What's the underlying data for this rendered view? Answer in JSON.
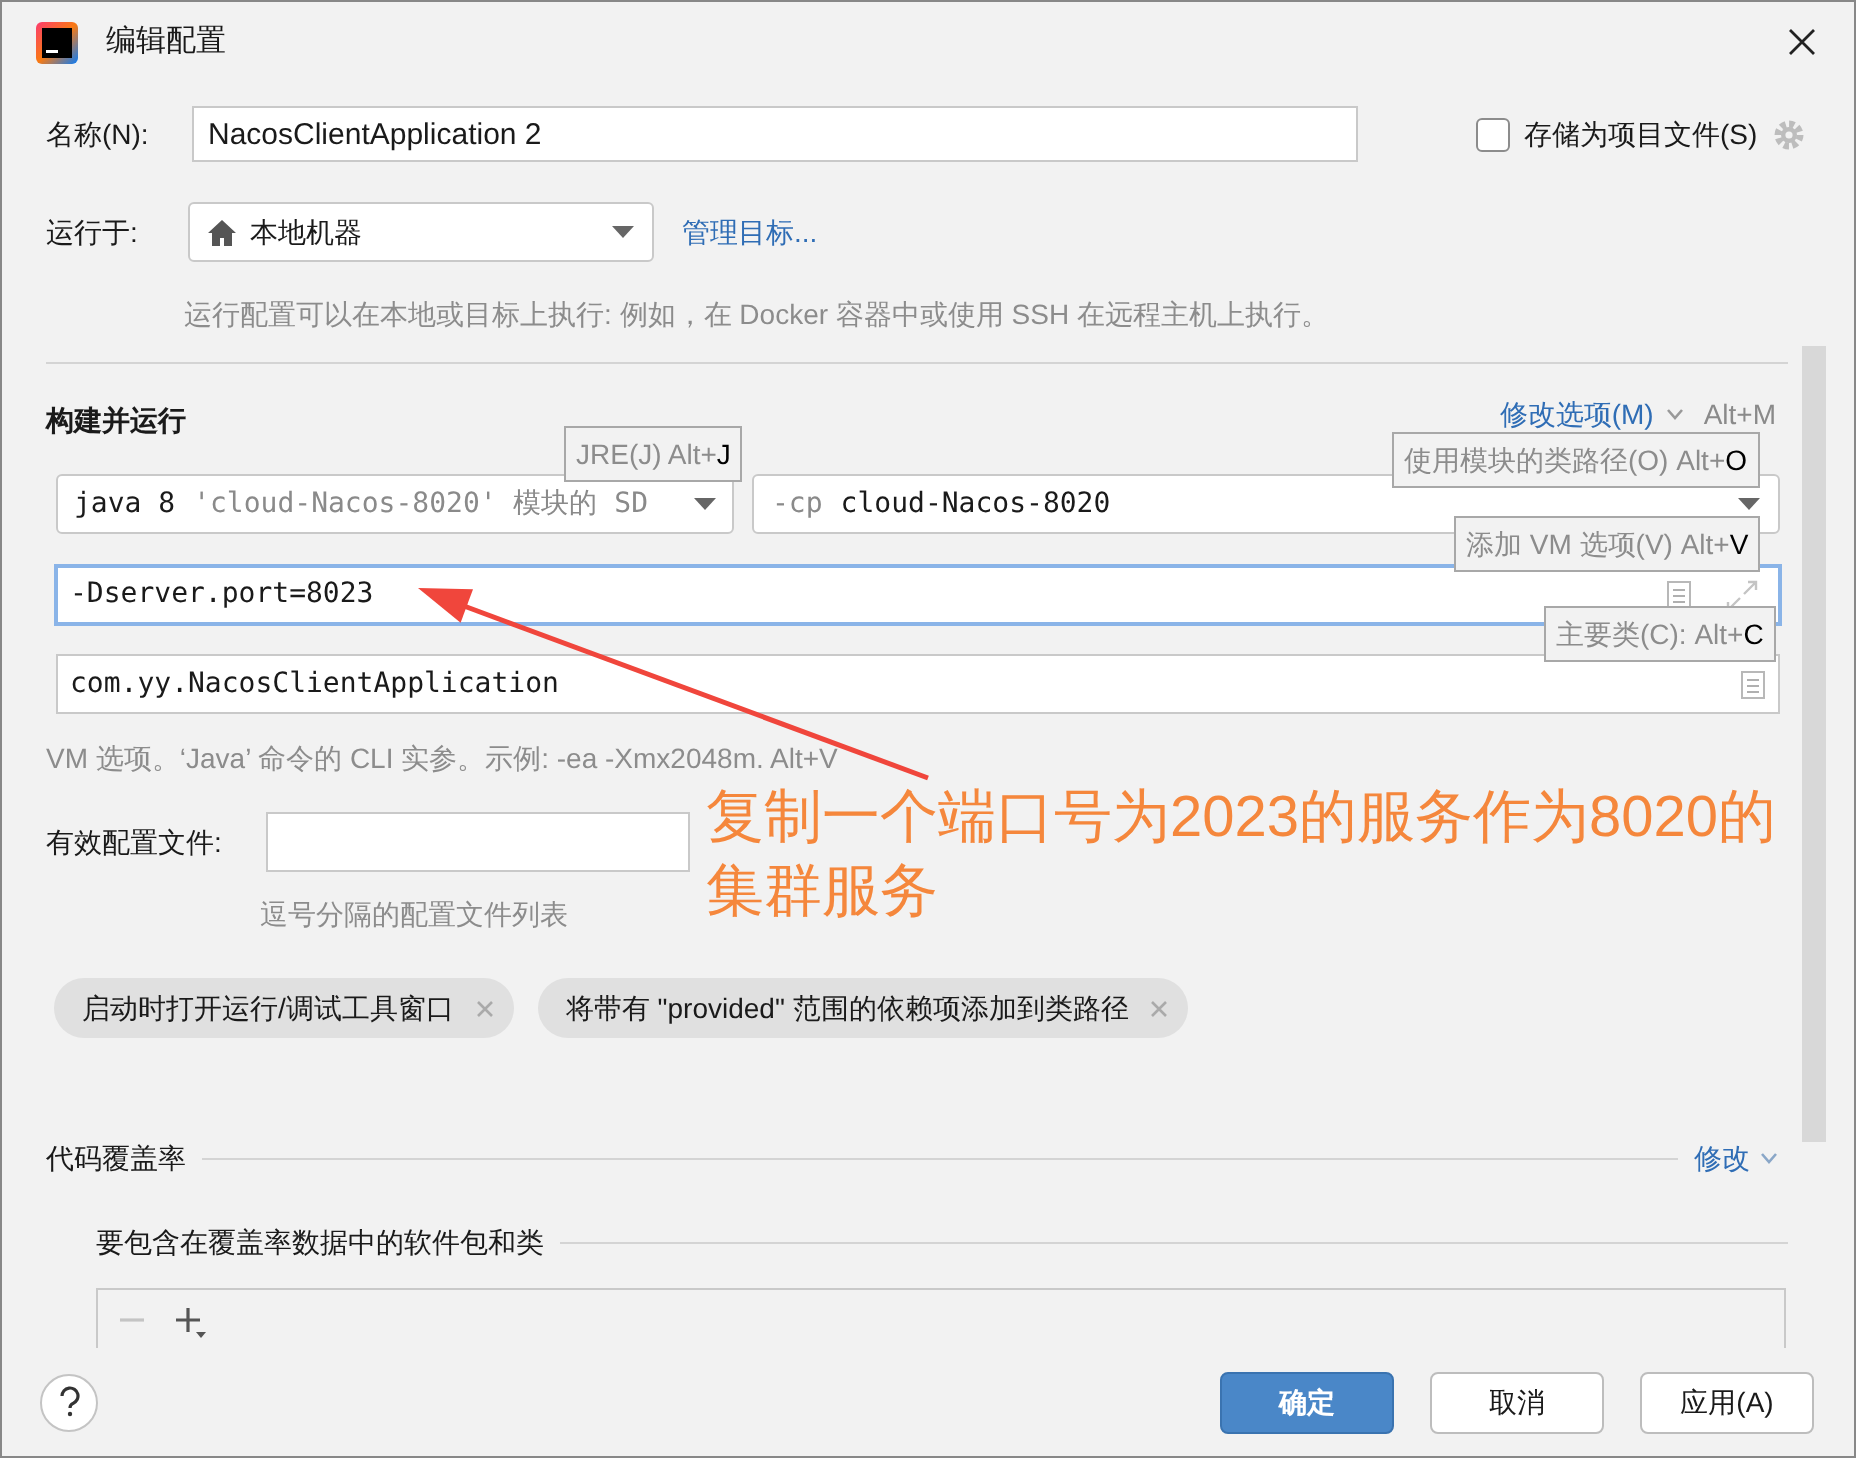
{
  "window": {
    "title": "编辑配置"
  },
  "name_field": {
    "label": "名称(N):",
    "value": "NacosClientApplication 2"
  },
  "store_as_project_file": {
    "label": "存储为项目文件(S)",
    "checked": false
  },
  "run_on": {
    "label": "运行于:",
    "value": "本地机器",
    "link": "管理目标...",
    "hint": "运行配置可以在本地或目标上执行: 例如，在 Docker 容器中或使用 SSH 在远程主机上执行。"
  },
  "build_and_run": {
    "title": "构建并运行",
    "modify_options": "修改选项(M)",
    "modify_shortcut": "Alt+M",
    "jre": {
      "value": "java 8",
      "detail": "'cloud-Nacos-8020' 模块的 SD"
    },
    "classpath": {
      "prefix": "-cp",
      "value": "cloud-Nacos-8020"
    },
    "vm_options": {
      "value": "-Dserver.port=8023",
      "focused": true
    },
    "main_class": {
      "value": "com.yy.NacosClientApplication"
    },
    "vm_hint": "VM 选项。‘Java’ 命令的 CLI 实参。示例: -ea -Xmx2048m. Alt+V",
    "profiles": {
      "label": "有效配置文件:",
      "hint": "逗号分隔的配置文件列表"
    },
    "tags": [
      {
        "label": "启动时打开运行/调试工具窗口"
      },
      {
        "label": "将带有 \"provided\" 范围的依赖项添加到类路径"
      }
    ]
  },
  "tooltips": [
    {
      "text": "JRE(J) Alt+",
      "key": "J"
    },
    {
      "text": "使用模块的类路径(O) Alt+",
      "key": "O"
    },
    {
      "text": "添加 VM 选项(V) Alt+",
      "key": "V"
    },
    {
      "text": "主要类(C): Alt+",
      "key": "C"
    }
  ],
  "code_coverage": {
    "title": "代码覆盖率",
    "modify": "修改",
    "packages_title": "要包含在覆盖率数据中的软件包和类",
    "toolbar": [
      {
        "kind": "remove",
        "disabled": true
      },
      {
        "kind": "add",
        "disabled": false
      }
    ]
  },
  "buttons": [
    {
      "label": "确定",
      "default": true
    },
    {
      "label": "取消",
      "default": false
    },
    {
      "label": "应用(A)",
      "default": false
    }
  ],
  "annotation": {
    "lines": [
      "复制一个端口号为2023的服务作为8020的",
      "集群服务"
    ]
  }
}
